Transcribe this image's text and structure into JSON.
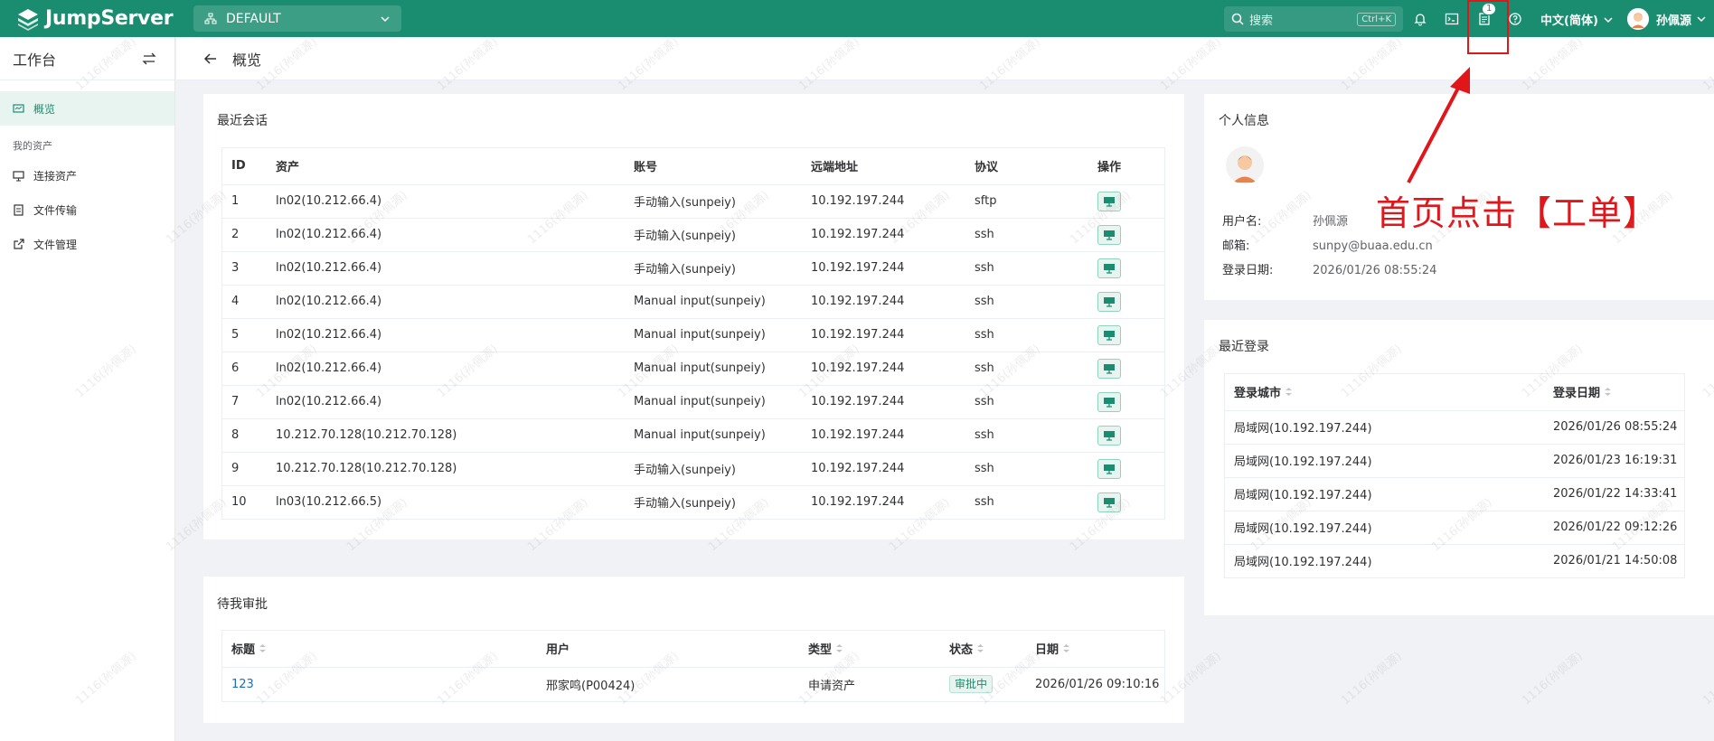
{
  "topbar": {
    "brand": "JumpServer",
    "org": "DEFAULT",
    "search_placeholder": "搜索",
    "search_shortcut": "Ctrl+K",
    "ticket_badge": "1",
    "language": "中文(简体)",
    "username": "孙佩源"
  },
  "sidebar": {
    "title": "工作台",
    "items": [
      {
        "label": "概览",
        "icon": "dashboard-icon"
      },
      {
        "label": "连接资产",
        "icon": "monitor-icon"
      },
      {
        "label": "文件传输",
        "icon": "file-icon"
      },
      {
        "label": "文件管理",
        "icon": "external-link-icon"
      }
    ],
    "group_label": "我的资产"
  },
  "page": {
    "title": "概览"
  },
  "recent_sessions": {
    "title": "最近会话",
    "columns": [
      "ID",
      "资产",
      "账号",
      "远端地址",
      "协议",
      "操作"
    ],
    "rows": [
      {
        "id": "1",
        "asset": "ln02(10.212.66.4)",
        "account": "手动输入(sunpeiy)",
        "addr": "10.192.197.244",
        "proto": "sftp"
      },
      {
        "id": "2",
        "asset": "ln02(10.212.66.4)",
        "account": "手动输入(sunpeiy)",
        "addr": "10.192.197.244",
        "proto": "ssh"
      },
      {
        "id": "3",
        "asset": "ln02(10.212.66.4)",
        "account": "手动输入(sunpeiy)",
        "addr": "10.192.197.244",
        "proto": "ssh"
      },
      {
        "id": "4",
        "asset": "ln02(10.212.66.4)",
        "account": "Manual input(sunpeiy)",
        "addr": "10.192.197.244",
        "proto": "ssh"
      },
      {
        "id": "5",
        "asset": "ln02(10.212.66.4)",
        "account": "Manual input(sunpeiy)",
        "addr": "10.192.197.244",
        "proto": "ssh"
      },
      {
        "id": "6",
        "asset": "ln02(10.212.66.4)",
        "account": "Manual input(sunpeiy)",
        "addr": "10.192.197.244",
        "proto": "ssh"
      },
      {
        "id": "7",
        "asset": "ln02(10.212.66.4)",
        "account": "Manual input(sunpeiy)",
        "addr": "10.192.197.244",
        "proto": "ssh"
      },
      {
        "id": "8",
        "asset": "10.212.70.128(10.212.70.128)",
        "account": "Manual input(sunpeiy)",
        "addr": "10.192.197.244",
        "proto": "ssh"
      },
      {
        "id": "9",
        "asset": "10.212.70.128(10.212.70.128)",
        "account": "手动输入(sunpeiy)",
        "addr": "10.192.197.244",
        "proto": "ssh"
      },
      {
        "id": "10",
        "asset": "ln03(10.212.66.5)",
        "account": "手动输入(sunpeiy)",
        "addr": "10.192.197.244",
        "proto": "ssh"
      }
    ]
  },
  "pending": {
    "title": "待我审批",
    "columns": [
      "标题",
      "用户",
      "类型",
      "状态",
      "日期"
    ],
    "rows": [
      {
        "title": "123",
        "user": "邢家鸣(P00424)",
        "type": "申请资产",
        "status": "审批中",
        "date": "2026/01/26 09:10:16"
      }
    ]
  },
  "profile": {
    "title": "个人信息",
    "fields": [
      {
        "key": "用户名:",
        "value": "孙佩源"
      },
      {
        "key": "邮箱:",
        "value": "sunpy@buaa.edu.cn"
      },
      {
        "key": "登录日期:",
        "value": "2026/01/26 08:55:24"
      }
    ]
  },
  "recent_logins": {
    "title": "最近登录",
    "columns": [
      "登录城市",
      "登录日期"
    ],
    "rows": [
      {
        "city": "局域网(10.192.197.244)",
        "date": "2026/01/26 08:55:24"
      },
      {
        "city": "局域网(10.192.197.244)",
        "date": "2026/01/23 16:19:31"
      },
      {
        "city": "局域网(10.192.197.244)",
        "date": "2026/01/22 14:33:41"
      },
      {
        "city": "局域网(10.192.197.244)",
        "date": "2026/01/22 09:12:26"
      },
      {
        "city": "局域网(10.192.197.244)",
        "date": "2026/01/21 14:50:08"
      }
    ]
  },
  "annotation": {
    "text": "首页点击【工单】",
    "color": "#e0161b"
  },
  "watermark": "1116(孙佩源)",
  "colors": {
    "brand": "#1a8d70",
    "link": "#1a6fb8"
  }
}
